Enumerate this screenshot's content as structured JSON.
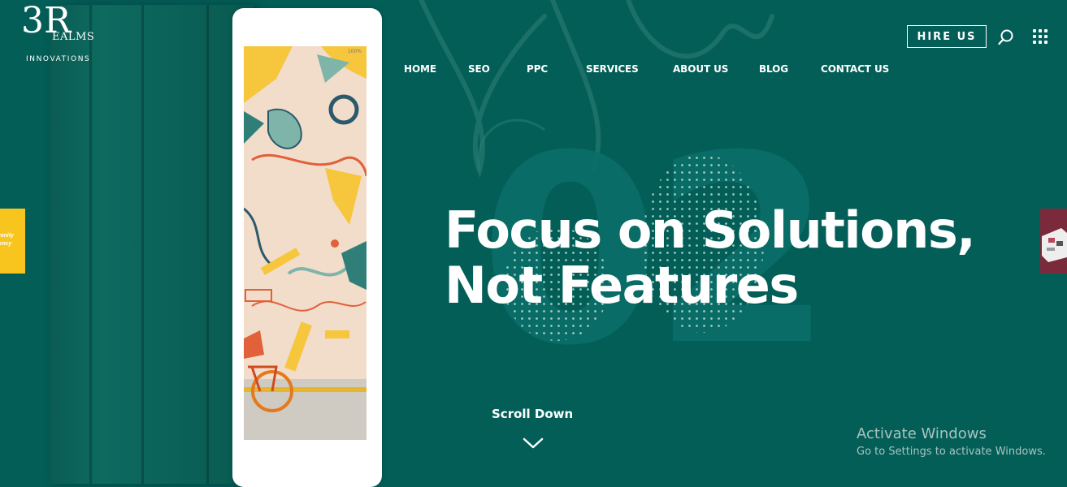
{
  "brand": {
    "mark": "3R",
    "name_line1": "EALMS",
    "name_line2": "INNOVATIONS"
  },
  "nav": {
    "items": [
      "HOME",
      "SEO",
      "PPC",
      "SERVICES",
      "ABOUT US",
      "BLOG",
      "CONTACT US"
    ],
    "cta_label": "HIRE US",
    "search_icon": "search-icon",
    "menu_icon": "grid-menu-icon"
  },
  "hero": {
    "slide_number": "02",
    "headline_line1": "Focus on Solutions,",
    "headline_line2": "Not Features",
    "scroll_label": "Scroll Down",
    "device_status": "100%"
  },
  "side_thumbs": {
    "prev_line1": "erenity",
    "prev_line2": "gency"
  },
  "os_watermark": {
    "title": "Activate Windows",
    "subtitle": "Go to Settings to activate Windows."
  },
  "colors": {
    "background": "#035e58",
    "text": "#ffffff",
    "prev_thumb": "#f7c51e",
    "next_thumb": "#7a2a3a"
  }
}
